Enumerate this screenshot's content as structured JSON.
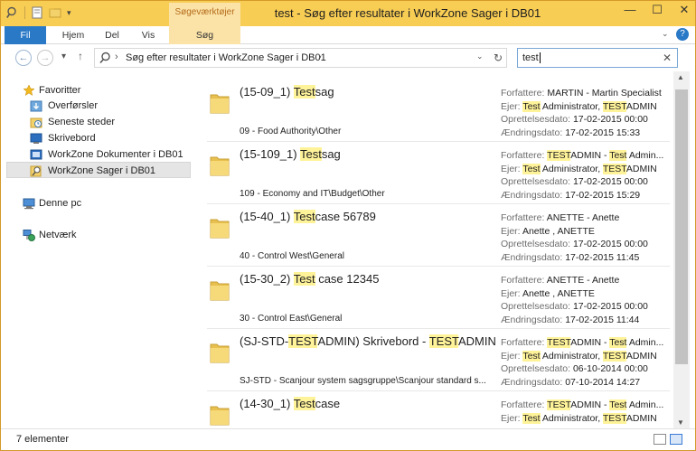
{
  "window": {
    "title": "test - Søg efter resultater i WorkZone Sager i DB01",
    "context_tab_header": "Søgeværktøjer",
    "controls": {
      "minimize": "—",
      "maximize": "☐",
      "close": "✕"
    }
  },
  "ribbon": {
    "tabs": [
      "Fil",
      "Hjem",
      "Del",
      "Vis",
      "Søg"
    ]
  },
  "navigation": {
    "back": "←",
    "forward": "→",
    "recent": "▾",
    "up": "↑",
    "address": "Søg efter resultater i WorkZone Sager i DB01",
    "address_chevron": "›",
    "refresh": "↻",
    "search_value": "test",
    "search_clear": "✕"
  },
  "sidebar": {
    "favorites": "Favoritter",
    "favorites_items": [
      "Overførsler",
      "Seneste steder",
      "Skrivebord",
      "WorkZone Dokumenter i DB01",
      "WorkZone Sager i DB01"
    ],
    "this_pc": "Denne pc",
    "network": "Netværk"
  },
  "labels": {
    "author": "Forfattere: ",
    "owner": "Ejer: ",
    "created": "Oprettelsesdato: ",
    "modified": "Ændringsdato: "
  },
  "results": [
    {
      "title_pre": "(15-09_1) ",
      "title_hl": "Test",
      "title_post": "sag",
      "path": "09 - Food Authority\\Other",
      "author_pre": "",
      "author_hl": "",
      "author_post": "MARTIN - Martin Specialist",
      "author_hl2": "",
      "author_post2": "",
      "owner_pre": "",
      "owner_hl": "Test",
      "owner_mid": " Administrator, ",
      "owner_hl2": "TEST",
      "owner_post": "ADMIN",
      "created": "17-02-2015 00:00",
      "modified": "17-02-2015 15:33"
    },
    {
      "title_pre": "(15-109_1) ",
      "title_hl": "Test",
      "title_post": "sag",
      "path": "109 - Economy and IT\\Budget\\Other",
      "author_pre": "",
      "author_hl": "TEST",
      "author_post": "ADMIN - ",
      "author_hl2": "Test",
      "author_post2": " Admin...",
      "owner_pre": "",
      "owner_hl": "Test",
      "owner_mid": " Administrator, ",
      "owner_hl2": "TEST",
      "owner_post": "ADMIN",
      "created": "17-02-2015 00:00",
      "modified": "17-02-2015 15:29"
    },
    {
      "title_pre": "(15-40_1) ",
      "title_hl": "Test",
      "title_post": "case 56789",
      "path": "40 - Control West\\General",
      "author_pre": "",
      "author_hl": "",
      "author_post": "ANETTE - Anette",
      "author_hl2": "",
      "author_post2": "",
      "owner_pre": "Anette , ANETTE",
      "owner_hl": "",
      "owner_mid": "",
      "owner_hl2": "",
      "owner_post": "",
      "created": "17-02-2015 00:00",
      "modified": "17-02-2015 11:45"
    },
    {
      "title_pre": "(15-30_2) ",
      "title_hl": "Test",
      "title_post": " case 12345",
      "path": "30 - Control East\\General",
      "author_pre": "",
      "author_hl": "",
      "author_post": "ANETTE - Anette",
      "author_hl2": "",
      "author_post2": "",
      "owner_pre": "Anette , ANETTE",
      "owner_hl": "",
      "owner_mid": "",
      "owner_hl2": "",
      "owner_post": "",
      "created": "17-02-2015 00:00",
      "modified": "17-02-2015 11:44"
    },
    {
      "title_pre": "(SJ-STD-",
      "title_hl": "TEST",
      "title_post": "ADMIN) Skrivebord - ",
      "title_hl2": "TEST",
      "title_post2": "ADMIN",
      "path": "SJ-STD - Scanjour system sagsgruppe\\Scanjour standard s...",
      "author_pre": "",
      "author_hl": "TEST",
      "author_post": "ADMIN - ",
      "author_hl2": "Test",
      "author_post2": " Admin...",
      "owner_pre": "",
      "owner_hl": "Test",
      "owner_mid": " Administrator, ",
      "owner_hl2": "TEST",
      "owner_post": "ADMIN",
      "created": "06-10-2014 00:00",
      "modified": "07-10-2014 14:27"
    },
    {
      "title_pre": "(14-30_1) ",
      "title_hl": "Test",
      "title_post": "case",
      "path": "",
      "author_pre": "",
      "author_hl": "TEST",
      "author_post": "ADMIN - ",
      "author_hl2": "Test",
      "author_post2": " Admin...",
      "owner_pre": "",
      "owner_hl": "Test",
      "owner_mid": " Administrator, ",
      "owner_hl2": "TEST",
      "owner_post": "ADMIN",
      "created": "",
      "modified": ""
    }
  ],
  "status": {
    "count": "7 elementer"
  },
  "colors": {
    "titlebar": "#f8cd54",
    "file_tab": "#2a79c7",
    "highlight": "#fff39a"
  }
}
